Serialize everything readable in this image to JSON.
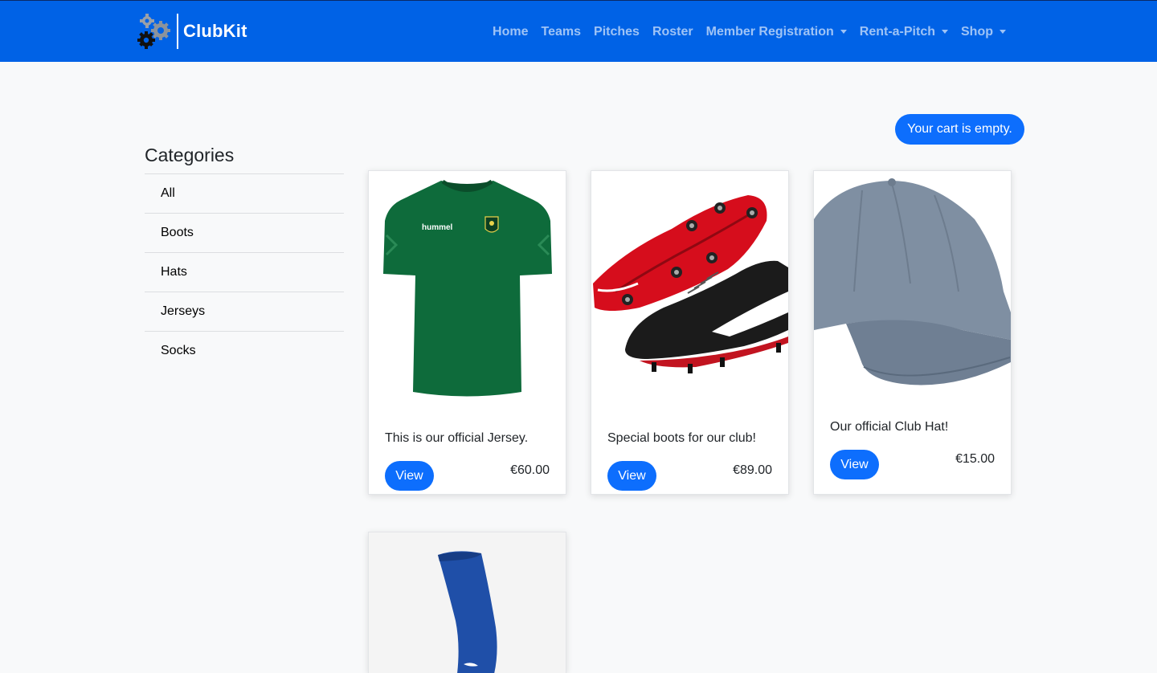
{
  "brand": {
    "name": "ClubKit"
  },
  "nav": {
    "items": [
      {
        "label": "Home"
      },
      {
        "label": "Teams"
      },
      {
        "label": "Pitches"
      },
      {
        "label": "Roster"
      },
      {
        "label": "Member Registration"
      },
      {
        "label": "Rent-a-Pitch"
      },
      {
        "label": "Shop"
      }
    ]
  },
  "cart": {
    "status": "Your cart is empty."
  },
  "categories": {
    "title": "Categories",
    "items": [
      "All",
      "Boots",
      "Hats",
      "Jerseys",
      "Socks"
    ]
  },
  "products": [
    {
      "description": "This is our official Jersey.",
      "price": "€60.00",
      "button": "View"
    },
    {
      "description": "Special boots for our club!",
      "price": "€89.00",
      "button": "View"
    },
    {
      "description": "Our official Club Hat!",
      "price": "€15.00",
      "button": "View"
    }
  ],
  "jersey_image": {
    "logo_text": "hummel"
  },
  "colors": {
    "navbar": "#0062e6",
    "accent": "#0d6efd",
    "jersey": "#0e6b3b",
    "cap": "#7f8fa2",
    "sock": "#1f4fa8"
  }
}
